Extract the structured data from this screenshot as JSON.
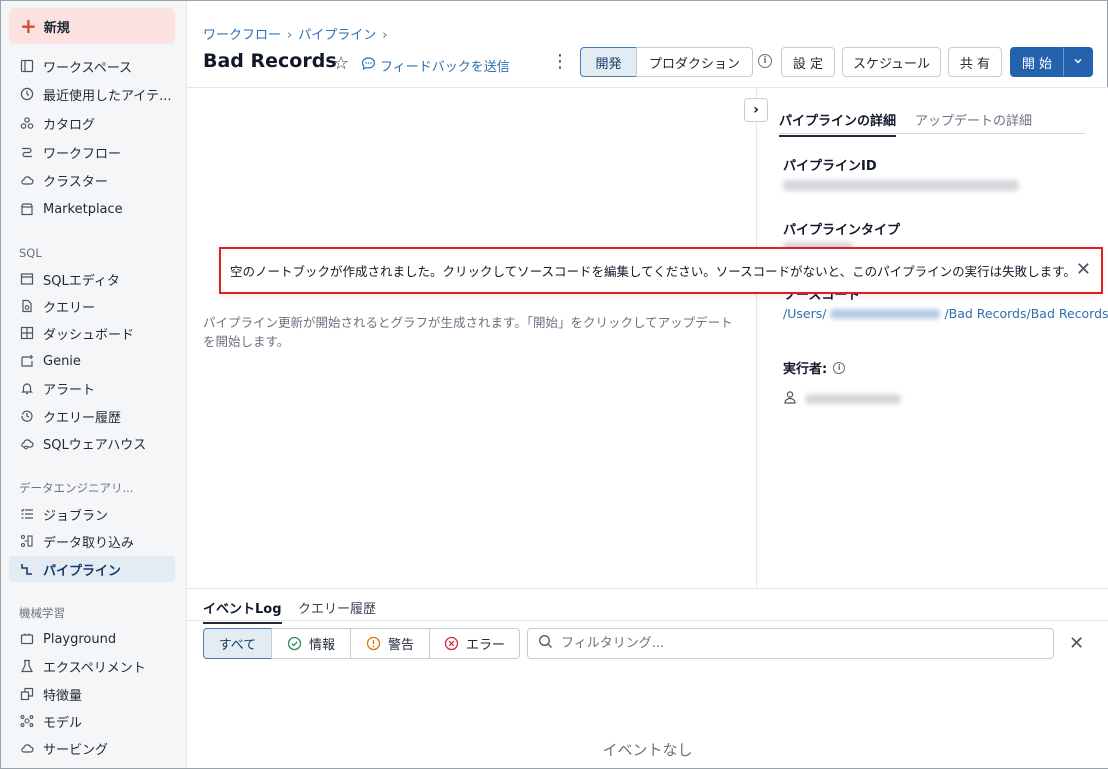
{
  "sidebar": {
    "new_label": "新規",
    "items": [
      {
        "label": "ワークスペース",
        "icon": "folder-icon"
      },
      {
        "label": "最近使用したアイテ...",
        "icon": "clock-icon"
      },
      {
        "label": "カタログ",
        "icon": "catalog-icon"
      },
      {
        "label": "ワークフロー",
        "icon": "workflow-icon"
      },
      {
        "label": "クラスター",
        "icon": "cloud-icon"
      },
      {
        "label": "Marketplace",
        "icon": "store-icon"
      }
    ],
    "sql_section": "SQL",
    "sql_items": [
      {
        "label": "SQLエディタ",
        "icon": "editor-icon"
      },
      {
        "label": "クエリー",
        "icon": "query-icon"
      },
      {
        "label": "ダッシュボード",
        "icon": "dashboard-icon"
      },
      {
        "label": "Genie",
        "icon": "genie-icon"
      },
      {
        "label": "アラート",
        "icon": "bell-icon"
      },
      {
        "label": "クエリー履歴",
        "icon": "history-icon"
      },
      {
        "label": "SQLウェアハウス",
        "icon": "warehouse-icon"
      }
    ],
    "de_section": "データエンジニアリ...",
    "de_items": [
      {
        "label": "ジョブラン",
        "icon": "jobs-icon"
      },
      {
        "label": "データ取り込み",
        "icon": "ingest-icon"
      },
      {
        "label": "パイプライン",
        "icon": "pipeline-icon",
        "active": true
      }
    ],
    "ml_section": "機械学習",
    "ml_items": [
      {
        "label": "Playground",
        "icon": "playground-icon"
      },
      {
        "label": "エクスペリメント",
        "icon": "experiment-icon"
      },
      {
        "label": "特徴量",
        "icon": "feature-icon"
      },
      {
        "label": "モデル",
        "icon": "model-icon"
      },
      {
        "label": "サービング",
        "icon": "serving-icon"
      }
    ]
  },
  "header": {
    "breadcrumb": [
      "ワークフロー",
      "パイプライン"
    ],
    "title": "Bad Records",
    "feedback": "フィードバックを送信",
    "mode_dev": "開発",
    "mode_prod": "プロダクション",
    "settings": "設 定",
    "schedule": "スケジュール",
    "share": "共 有",
    "start": "開 始"
  },
  "graph": {
    "empty_message": "パイプライン更新が開始されるとグラフが生成されます。「開始」をクリックしてアップデートを開始します。"
  },
  "panel": {
    "tab_details": "パイプラインの詳細",
    "tab_update": "アップデートの詳細",
    "id_label": "パイプラインID",
    "type_label": "パイプラインタイプ",
    "source_label": "ソースコード",
    "source_prefix": "/Users/",
    "source_suffix": "/Bad Records/Bad Records",
    "runner_label": "実行者:"
  },
  "events": {
    "tab_log": "イベントLog",
    "tab_history": "クエリー履歴",
    "filter_all": "すべて",
    "filter_info": "情報",
    "filter_warn": "警告",
    "filter_error": "エラー",
    "search_placeholder": "フィルタリング...",
    "empty": "イベントなし"
  },
  "notification": {
    "message": "空のノートブックが作成されました。クリックしてソースコードを編集してください。ソースコードがないと、このパイプラインの実行は失敗します。"
  },
  "colors": {
    "accent": "#2462ad",
    "highlight_border": "#e02020",
    "new_button_bg": "#fbe1df"
  }
}
